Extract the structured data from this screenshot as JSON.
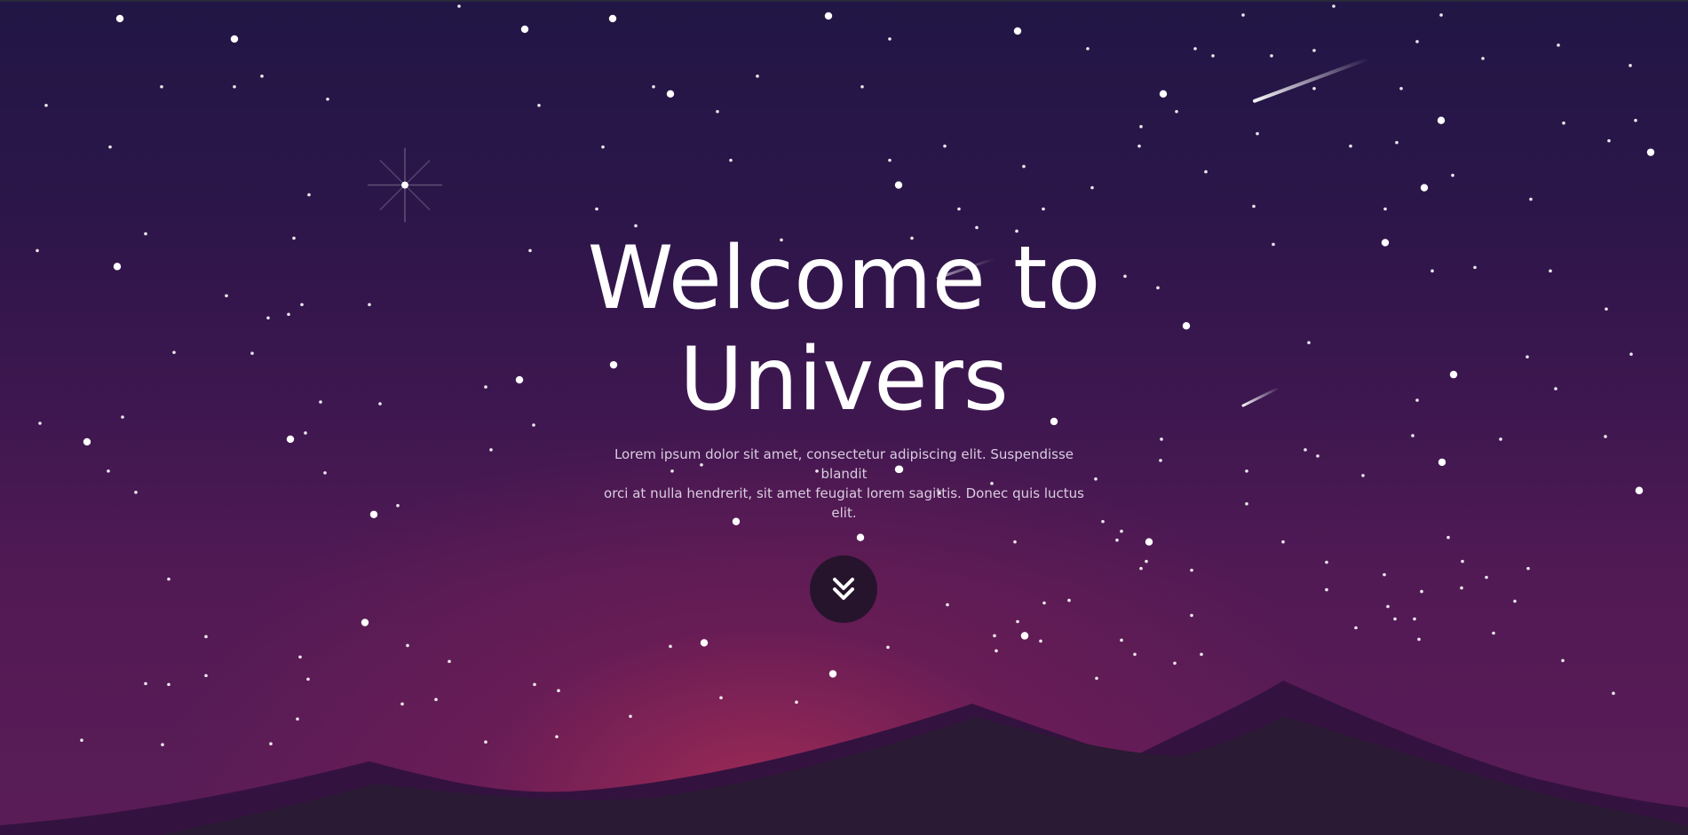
{
  "hero": {
    "title_line1": "Welcome to",
    "title_line2": "Univers",
    "subtitle_line1": "Lorem ipsum dolor sit amet, consectetur adipiscing elit. Suspendisse blandit",
    "subtitle_line2": "orci at nulla hendrerit, sit amet feugiat lorem sagittis. Donec quis luctus elit."
  },
  "scroll_button": {
    "icon": "double-chevron-down-icon"
  },
  "colors": {
    "sky_top": "#211645",
    "sky_glow": "#aa2d55",
    "mountain_back": "#34123f",
    "mountain_front": "#2a1a33",
    "text": "#ffffff",
    "button_bg": "#26142c"
  }
}
